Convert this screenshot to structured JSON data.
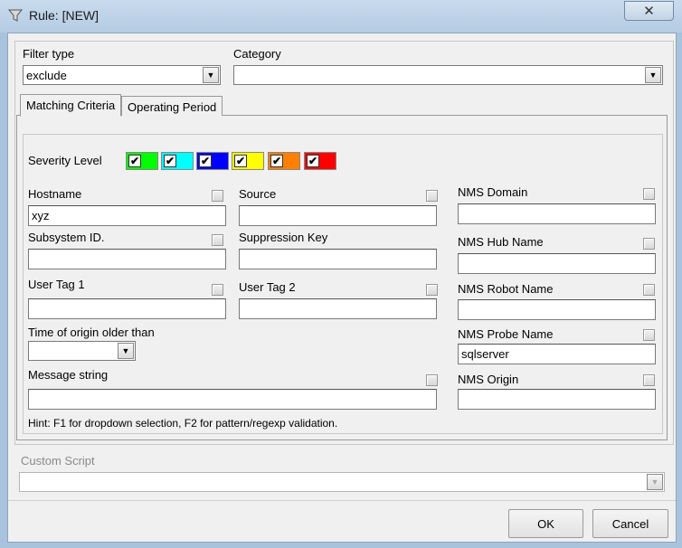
{
  "window": {
    "title": "Rule: [NEW]",
    "close_label": "✕"
  },
  "filter_type": {
    "label": "Filter type",
    "value": "exclude"
  },
  "category": {
    "label": "Category",
    "value": ""
  },
  "tabs": [
    {
      "label": "Matching Criteria"
    },
    {
      "label": "Operating Period"
    }
  ],
  "severity": {
    "label": "Severity Level",
    "levels": [
      {
        "color": "#00ff00",
        "checked": "✔"
      },
      {
        "color": "#00ffff",
        "checked": "✔"
      },
      {
        "color": "#0000ff",
        "checked": "✔"
      },
      {
        "color": "#ffff00",
        "checked": "✔"
      },
      {
        "color": "#ff8000",
        "checked": "✔"
      },
      {
        "color": "#ff0000",
        "checked": "✔"
      }
    ]
  },
  "fields": {
    "hostname": {
      "label": "Hostname",
      "value": "xyz"
    },
    "source": {
      "label": "Source",
      "value": ""
    },
    "nms_domain": {
      "label": "NMS Domain",
      "value": ""
    },
    "subsystem_id": {
      "label": "Subsystem ID.",
      "value": ""
    },
    "suppression_key": {
      "label": "Suppression Key",
      "value": ""
    },
    "nms_hub_name": {
      "label": "NMS Hub Name",
      "value": ""
    },
    "user_tag_1": {
      "label": "User Tag 1",
      "value": ""
    },
    "user_tag_2": {
      "label": "User Tag 2",
      "value": ""
    },
    "nms_robot_name": {
      "label": "NMS Robot Name",
      "value": ""
    },
    "time_of_origin": {
      "label": "Time of origin older than",
      "value": ""
    },
    "nms_probe_name": {
      "label": "NMS Probe Name",
      "value": "sqlserver"
    },
    "message_string": {
      "label": "Message string",
      "value": ""
    },
    "nms_origin": {
      "label": "NMS Origin",
      "value": ""
    }
  },
  "hint": "Hint: F1 for dropdown selection, F2 for pattern/regexp validation.",
  "custom_script": {
    "label": "Custom Script",
    "value": ""
  },
  "buttons": {
    "ok": "OK",
    "cancel": "Cancel"
  }
}
